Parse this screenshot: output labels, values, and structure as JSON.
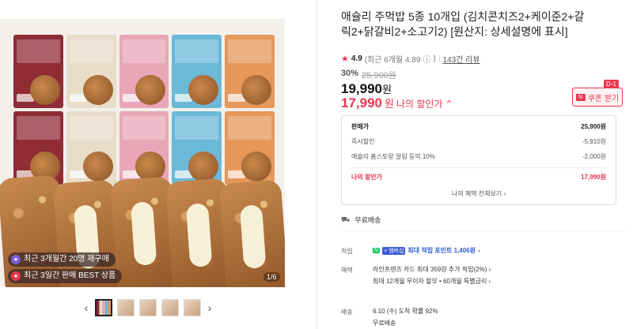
{
  "gallery": {
    "badges": [
      {
        "icon": "purple-sticker-icon",
        "text": "최근 3개월간 20명 재구매"
      },
      {
        "icon": "red-sticker-icon",
        "text": "최근 3일간 판매 BEST 상품"
      }
    ],
    "counter": "1/6",
    "prev_arrow": "‹",
    "next_arrow": "›"
  },
  "product": {
    "title": "애슐리 주먹밥 5종 10개입 (김치콘치즈2+케이준2+갈릭2+닭갈비2+소고기2) [원산지: 상세설명에 표시]",
    "rating": {
      "score": "4.9",
      "recent": "(최근 6개월 4.89",
      "recent_close": ")",
      "reviews": "143건 리뷰"
    },
    "discount_rate": "30%",
    "original_price": "25,900원",
    "price": "19,990",
    "price_unit": "원",
    "my_price": "17,990",
    "my_price_unit": "원",
    "my_price_label": "나의 할인가"
  },
  "coupon": {
    "badge": "D-1",
    "label": "쿠폰 받기"
  },
  "breakdown": {
    "rows": [
      {
        "label": "판매가",
        "value": "25,900원"
      },
      {
        "label": "즉시할인",
        "value": "-5,910원"
      },
      {
        "label": "애슐리 홈스토랑 알림 동의 10%",
        "value": "-2,000원"
      }
    ],
    "mine": {
      "label": "나의 할인가",
      "value": "17,990원"
    },
    "more": "나의 혜택 전체보기"
  },
  "shipping": {
    "label": "무료배송"
  },
  "points": {
    "label": "적립",
    "n_badge": "N",
    "membership_badge": "+ 멤버십",
    "text": "최대 적립 포인트 1,406원"
  },
  "benefits": {
    "label": "혜택",
    "lines": [
      "라인프렌즈 카드 최대 359원 추가 적립(2%)",
      "최대 12개월 무이자 할부 • 60개월 특별금리"
    ]
  },
  "delivery": {
    "label": "배송",
    "lines": [
      "6.10 (수) 도착 확률 92%",
      "무료배송"
    ]
  },
  "colors": {
    "accent": "#e8384f",
    "naver_green": "#03c75a",
    "link_blue": "#2e5bd6"
  }
}
